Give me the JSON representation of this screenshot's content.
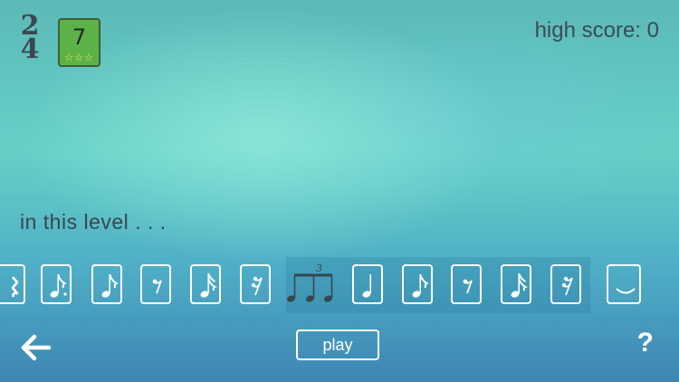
{
  "header": {
    "time_signature": {
      "top": "2",
      "bottom": "4"
    },
    "level": {
      "number": "7",
      "stars": "☆☆☆"
    },
    "high_score": "high score: 0"
  },
  "intro_text": "in this level . . .",
  "note_strip": {
    "items": [
      {
        "icon": "quarter-rest-icon"
      },
      {
        "icon": "dotted-eighth-note-icon"
      },
      {
        "icon": "eighth-note-icon"
      },
      {
        "icon": "eighth-rest-icon"
      },
      {
        "icon": "sixteenth-note-icon"
      },
      {
        "icon": "sixteenth-rest-icon"
      },
      {
        "icon": "eighth-note-triplet-icon",
        "label": "3",
        "highlighted": true
      },
      {
        "icon": "quarter-note-icon"
      },
      {
        "icon": "eighth-note-icon"
      },
      {
        "icon": "eighth-rest-icon"
      },
      {
        "icon": "sixteenth-note-icon"
      },
      {
        "icon": "sixteenth-rest-icon"
      },
      {
        "icon": "tie-icon"
      }
    ]
  },
  "footer": {
    "back_icon": "back-arrow-icon",
    "play_label": "play",
    "help_label": "?"
  },
  "colors": {
    "badge_green": "#5db247",
    "star_yellow": "#f0f25a",
    "text_dark": "#37464f",
    "card_border": "#ffffff"
  }
}
